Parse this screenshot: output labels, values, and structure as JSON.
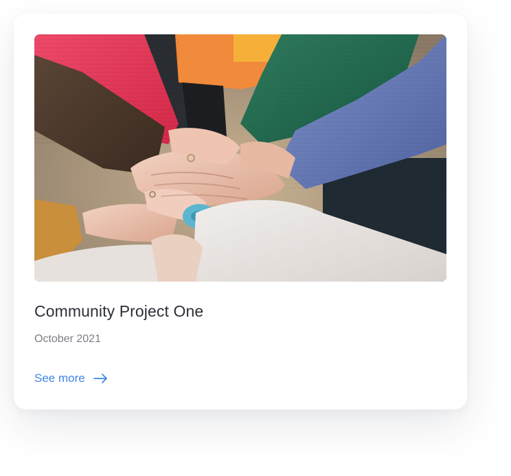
{
  "card": {
    "title": "Community Project One",
    "date": "October 2021",
    "link_label": "See more",
    "link_icon": "arrow-right-icon"
  },
  "colors": {
    "accent": "#3f86e8",
    "title": "#2b2f36",
    "muted": "#7a7d83",
    "card_background": "#ffffff"
  }
}
